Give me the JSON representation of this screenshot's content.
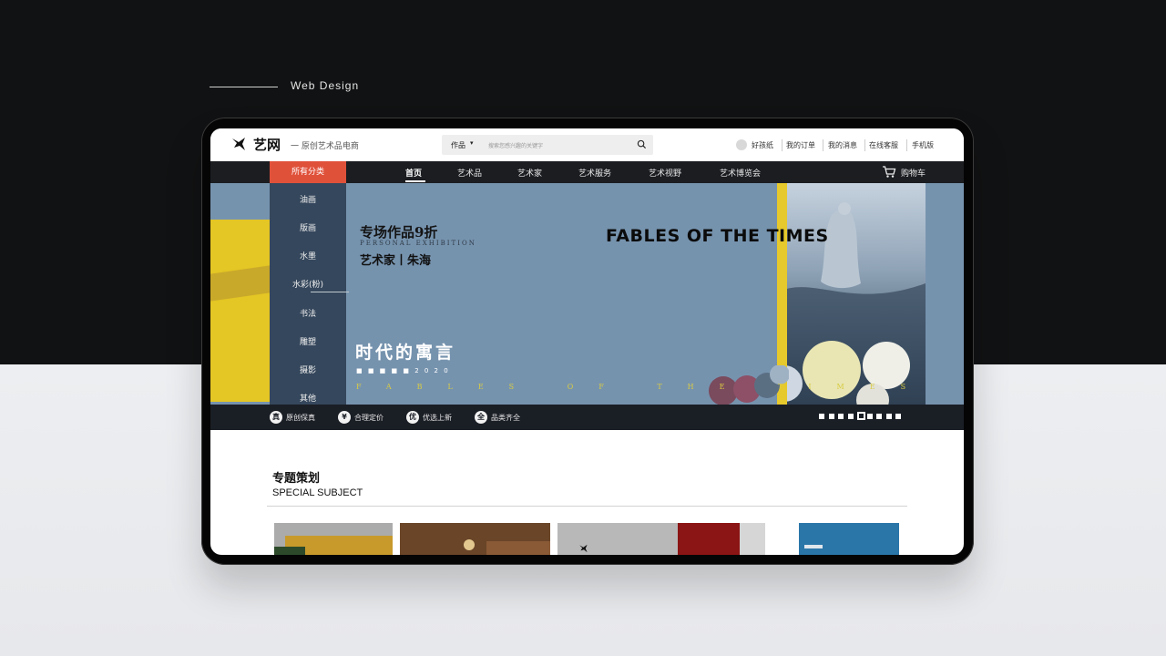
{
  "presentation": {
    "label": "Web Design"
  },
  "header": {
    "brand": "艺网",
    "slogan": "一 原创艺术品电商",
    "search": {
      "category": "作品",
      "placeholder": "搜索您感兴趣的关键字"
    },
    "links": [
      "好孩纸",
      "我的订单",
      "我的消息",
      "在线客服",
      "手机版"
    ]
  },
  "nav": {
    "all_categories": "所有分类",
    "items": [
      "首页",
      "艺术品",
      "艺术家",
      "艺术服务",
      "艺术视野",
      "艺术博览会"
    ],
    "active": "首页",
    "cart": "购物车"
  },
  "category_menu": [
    "油画",
    "版画",
    "水墨",
    "水彩(粉)",
    "书法",
    "雕塑",
    "摄影",
    "其他"
  ],
  "banner": {
    "promo": "专场作品9折",
    "promo_en": "PERSONAL EXHIBITION",
    "artist": "艺术家丨朱海",
    "title_en": "FABLES OF THE TIMES",
    "title_cn": "时代的寓言",
    "year_line": "■ ■ ■ ■ ■ 2 0 2 0",
    "fables_spaced": "FABLES OF THE TIMES",
    "slide_count": 9,
    "active_slide": 4
  },
  "features": [
    {
      "icon": "真",
      "label": "原创保真"
    },
    {
      "icon": "¥",
      "label": "合理定价"
    },
    {
      "icon": "优",
      "label": "优选上新"
    },
    {
      "icon": "全",
      "label": "品类齐全"
    }
  ],
  "section": {
    "title": "专题策划",
    "subtitle": "SPECIAL SUBJECT"
  },
  "colors": {
    "accent": "#e0513a",
    "nav_bg": "#1b1d21",
    "banner_bg": "#7693ae"
  }
}
